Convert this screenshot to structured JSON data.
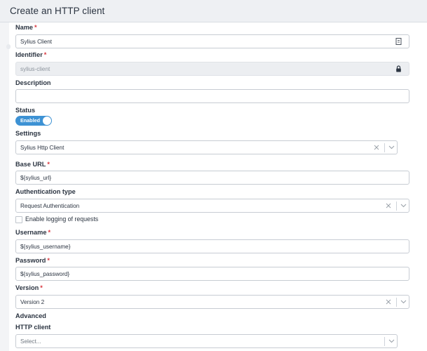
{
  "header": {
    "title": "Create an HTTP client"
  },
  "form": {
    "name": {
      "label": "Name",
      "required_mark": "*",
      "value": "Sylius Client",
      "icon": "document-icon"
    },
    "identifier": {
      "label": "Identifier",
      "required_mark": "*",
      "value": "sylius-client",
      "icon": "lock-icon"
    },
    "description": {
      "label": "Description",
      "value": ""
    },
    "status": {
      "label": "Status",
      "toggle_label": "Enabled",
      "enabled": true
    },
    "settings": {
      "label": "Settings",
      "value": "Sylius Http Client"
    },
    "base_url": {
      "label": "Base URL",
      "required_mark": "*",
      "value": "${sylius_url}"
    },
    "authentication_type": {
      "label": "Authentication type",
      "value": "Request Authentication"
    },
    "logging": {
      "label": "Enable logging of requests",
      "checked": false
    },
    "username": {
      "label": "Username",
      "required_mark": "*",
      "value": "${sylius_username}"
    },
    "password": {
      "label": "Password",
      "required_mark": "*",
      "value": "${sylius_password}"
    },
    "version": {
      "label": "Version",
      "required_mark": "*",
      "value": "Version 2"
    },
    "advanced": {
      "label": "Advanced"
    },
    "http_client": {
      "label": "HTTP client",
      "placeholder": "Select..."
    }
  },
  "colors": {
    "accent": "#3d92d4",
    "required": "#d9363e",
    "header_bg": "#eef0f3"
  }
}
